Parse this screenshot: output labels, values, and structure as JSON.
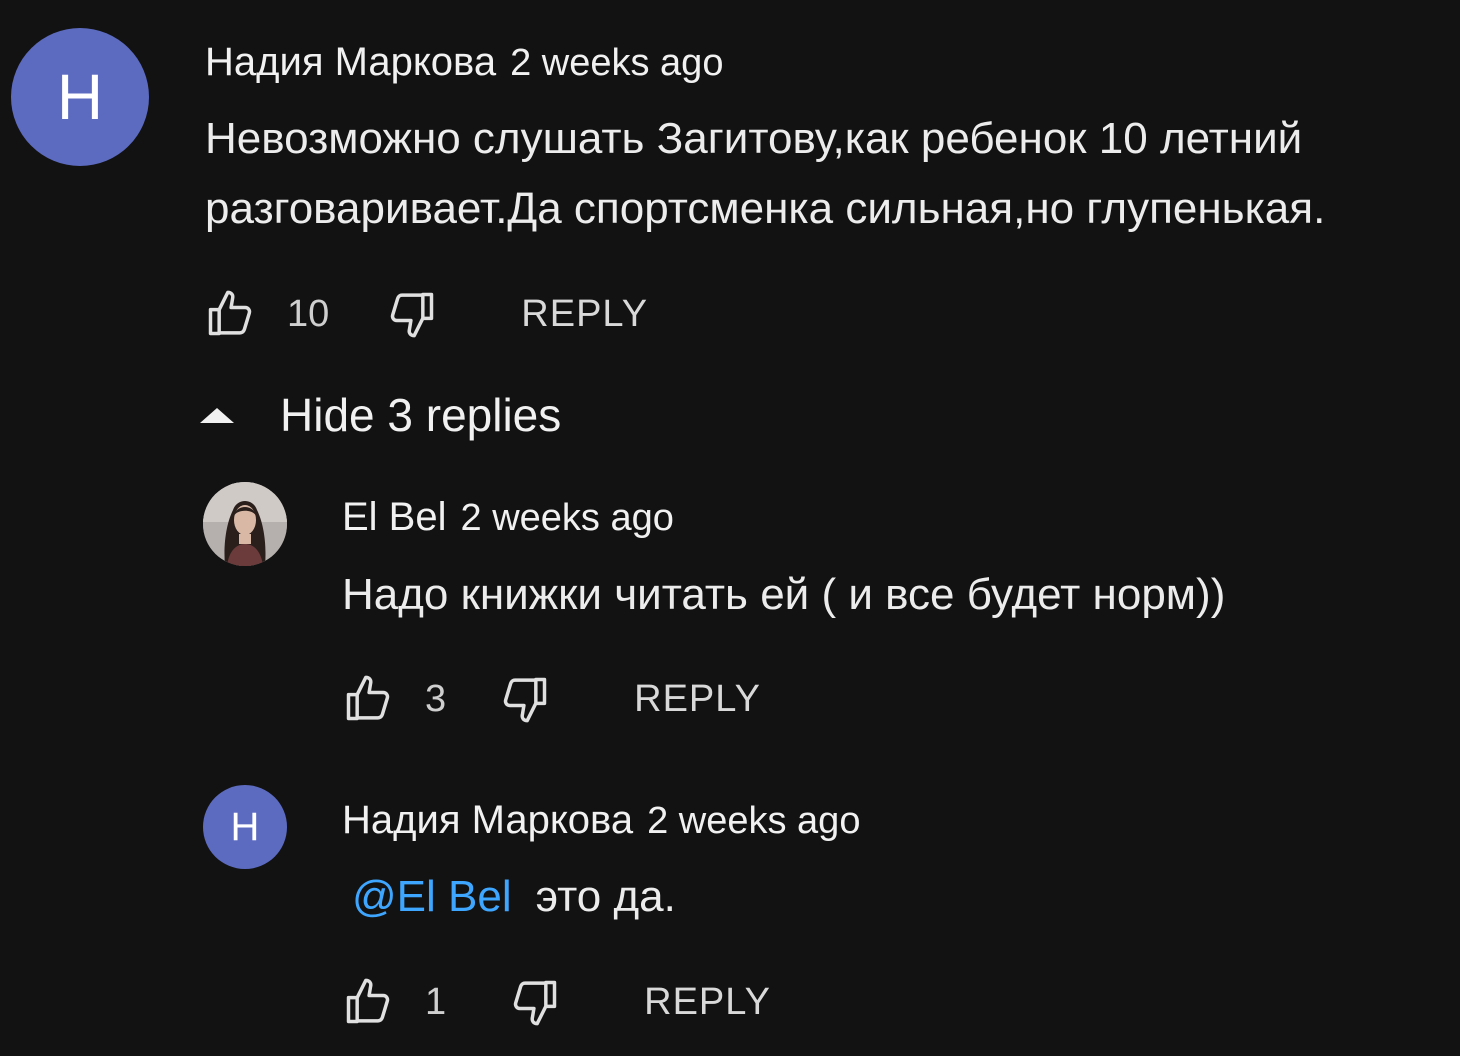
{
  "colors": {
    "background": "#121212",
    "avatar_letter_bg": "#5c6bc0",
    "mention": "#3ea6ff"
  },
  "top_comment": {
    "avatar_letter": "H",
    "author": "Надия Маркова",
    "time": "2 weeks ago",
    "text_line1": "Невозможно слушать Загитову,как ребенок 10 летний",
    "text_line2": "разговаривает.Да спортсменка сильная,но глупенькая.",
    "likes": "10",
    "reply_label": "REPLY",
    "like_icon": "thumb-up-icon",
    "dislike_icon": "thumb-down-icon"
  },
  "replies_toggle": {
    "label": "Hide 3 replies",
    "icon": "caret-up-icon"
  },
  "replies": [
    {
      "avatar": "photo",
      "author": "El Bel",
      "time": "2 weeks ago",
      "text": "Надо книжки читать ей ( и все будет норм))",
      "likes": "3",
      "reply_label": "REPLY"
    },
    {
      "avatar_letter": "H",
      "author": "Надия Маркова",
      "time": "2 weeks ago",
      "mention": "@El Bel",
      "text": "это да.",
      "likes": "1",
      "reply_label": "REPLY"
    }
  ]
}
